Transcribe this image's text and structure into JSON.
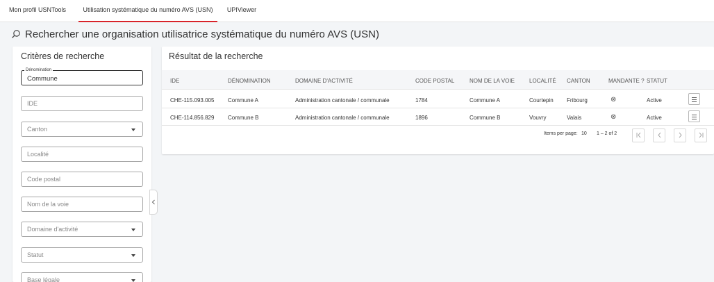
{
  "nav": {
    "tabs": [
      {
        "label": "Mon profil USNTools"
      },
      {
        "label": "Utilisation systématique du numéro AVS (USN)"
      },
      {
        "label": "UPIViewer"
      }
    ]
  },
  "page": {
    "title": "Rechercher une organisation utilisatrice systématique du numéro AVS (USN)"
  },
  "search_panel": {
    "title": "Critères de recherche",
    "denomination": {
      "label": "Dénomination",
      "value": "Commune"
    },
    "ide": {
      "placeholder": "IDE"
    },
    "canton": {
      "placeholder": "Canton"
    },
    "localite": {
      "placeholder": "Localité"
    },
    "code_postal": {
      "placeholder": "Code postal"
    },
    "nom_voie": {
      "placeholder": "Nom de la voie"
    },
    "domaine": {
      "placeholder": "Domaine d'activité"
    },
    "statut": {
      "placeholder": "Statut"
    },
    "base_legale": {
      "placeholder": "Base légale"
    }
  },
  "results": {
    "title": "Résultat de la recherche",
    "headers": [
      "IDE",
      "DÉNOMINATION",
      "DOMAINE D'ACTIVITÉ",
      "CODE POSTAL",
      "NOM DE LA VOIE",
      "LOCALITÉ",
      "CANTON",
      "MANDANTE ?",
      "STATUT"
    ],
    "rows": [
      {
        "ide": "CHE-115.093.005",
        "denomination": "Commune A",
        "domaine": "Administration cantonale / communale",
        "code_postal": "1784",
        "nom_voie": "Commune A",
        "localite": "Courtepin",
        "canton": "Fribourg",
        "mandante": "⊗",
        "statut": "Active"
      },
      {
        "ide": "CHE-114.856.829",
        "denomination": "Commune B",
        "domaine": "Administration cantonale / communale",
        "code_postal": "1896",
        "nom_voie": "Commune B",
        "localite": "Vouvry",
        "canton": "Valais",
        "mandante": "⊗",
        "statut": "Active"
      }
    ],
    "paginator": {
      "items_per_page_label": "Items per page:",
      "items_per_page": "10",
      "range": "1 – 2 of 2",
      "first_icon": "first-page-icon",
      "prev_icon": "chevron-left-icon",
      "next_icon": "chevron-right-icon",
      "last_icon": "last-page-icon"
    }
  },
  "colors": {
    "accent": "#d8232a",
    "background": "#f3f5f7",
    "panel": "#ffffff",
    "header_row": "#f5f6f8"
  }
}
